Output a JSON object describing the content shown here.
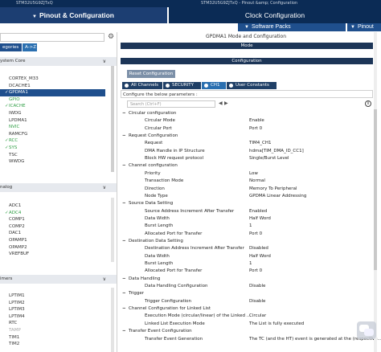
{
  "top": {
    "crumbs_left": "STM32U5G9ZJTxQ",
    "crumbs_mid": "&gt; Pinout &amp; Configuration",
    "crumbs_right": "STM32U5G9ZJTxQ - Pinout &amp; Configuration"
  },
  "tabs": {
    "pinout": "Pinout & Configuration",
    "clock": "Clock Configuration"
  },
  "subtabs": {
    "software_packs": "Software Packs",
    "pinout": "Pinout"
  },
  "left": {
    "category_a": "egories",
    "category_b": "A->Z",
    "sections": [
      {
        "label": "ystem Core",
        "chev": "∨"
      },
      {
        "label": "nalog",
        "chev": "∨"
      },
      {
        "label": "imers",
        "chev": "∨"
      }
    ],
    "system_core_items": [
      {
        "label": "CORTEX_M33",
        "check": "",
        "style": ""
      },
      {
        "label": "DCACHE1",
        "check": "",
        "style": ""
      },
      {
        "label": "GPDMA1",
        "check": "✓",
        "style": "sel"
      },
      {
        "label": "GPIO",
        "check": "",
        "style": "green"
      },
      {
        "label": "ICACHE",
        "check": "✓",
        "style": "green"
      },
      {
        "label": "IWDG",
        "check": "",
        "style": ""
      },
      {
        "label": "LPDMA1",
        "check": "",
        "style": ""
      },
      {
        "label": "NVIC",
        "check": "",
        "style": "green"
      },
      {
        "label": "RAMCFG",
        "check": "",
        "style": ""
      },
      {
        "label": "RCC",
        "check": "✓",
        "style": "green"
      },
      {
        "label": "SYS",
        "check": "✓",
        "style": "green"
      },
      {
        "label": "TSC",
        "check": "",
        "style": ""
      },
      {
        "label": "WWDG",
        "check": "",
        "style": ""
      }
    ],
    "analog_items": [
      {
        "label": "ADC1",
        "check": "",
        "style": ""
      },
      {
        "label": "ADC4",
        "check": "✓",
        "style": "green"
      },
      {
        "label": "COMP1",
        "check": "",
        "style": ""
      },
      {
        "label": "COMP2",
        "check": "",
        "style": ""
      },
      {
        "label": "DAC1",
        "check": "",
        "style": ""
      },
      {
        "label": "OPAMP1",
        "check": "",
        "style": ""
      },
      {
        "label": "OPAMP2",
        "check": "",
        "style": ""
      },
      {
        "label": "VREFBUF",
        "check": "",
        "style": ""
      }
    ],
    "timers_items": [
      {
        "label": "LPTIM1",
        "check": "",
        "style": ""
      },
      {
        "label": "LPTIM2",
        "check": "",
        "style": ""
      },
      {
        "label": "LPTIM3",
        "check": "",
        "style": ""
      },
      {
        "label": "LPTIM4",
        "check": "",
        "style": ""
      },
      {
        "label": "RTC",
        "check": "",
        "style": ""
      },
      {
        "label": "TAMP",
        "check": "",
        "style": "gray"
      },
      {
        "label": "TIM1",
        "check": "",
        "style": ""
      },
      {
        "label": "TIM2",
        "check": "",
        "style": ""
      }
    ]
  },
  "right": {
    "title": "GPDMA1 Mode and Configuration",
    "mode_bar": "Mode",
    "config_bar": "Configuration",
    "reset_button": "Reset Configuration",
    "channel_tabs": [
      {
        "label": "All Channels",
        "active": false
      },
      {
        "label": "SECURITY",
        "active": false
      },
      {
        "label": "CH1",
        "active": true
      },
      {
        "label": "User Constants",
        "active": false
      }
    ],
    "configure_text": "Configure the below parameters :",
    "search_placeholder": "Search (Ctrl+F)",
    "groups": [
      {
        "title": "Circular configuration",
        "params": [
          {
            "name": "Circular Mode",
            "value": "Enable"
          },
          {
            "name": "Circular Port",
            "value": "Port 0"
          }
        ]
      },
      {
        "title": "Request Configuration",
        "params": [
          {
            "name": "Request",
            "value": "TIM4_CH1"
          },
          {
            "name": "DMA Handle in IP Structure",
            "value": "hdma[TIM_DMA_ID_CC1]"
          },
          {
            "name": "Block HW request protocol",
            "value": "Single/Burst Level"
          }
        ]
      },
      {
        "title": "Channel configuration",
        "params": [
          {
            "name": "Priority",
            "value": "Low"
          },
          {
            "name": "Transaction Mode",
            "value": "Normal"
          },
          {
            "name": "Direction",
            "value": "Memory To Peripheral"
          },
          {
            "name": "Node Type",
            "value": "GPDMA Linear Addressing"
          }
        ]
      },
      {
        "title": "Source Data Setting",
        "params": [
          {
            "name": "Source Address Increment After Transfer",
            "value": "Enabled"
          },
          {
            "name": "Data Width",
            "value": "Half Word"
          },
          {
            "name": "Burst Length",
            "value": "1"
          },
          {
            "name": "Allocated Port for Transfer",
            "value": "Port 0"
          }
        ]
      },
      {
        "title": "Destination Data Setting",
        "params": [
          {
            "name": "Destination Address Increment After Transfer",
            "value": "Disabled"
          },
          {
            "name": "Data Width",
            "value": "Half Word"
          },
          {
            "name": "Burst Length",
            "value": "1"
          },
          {
            "name": "Allocated Port for Transfer",
            "value": "Port 0"
          }
        ]
      },
      {
        "title": "Data Handling",
        "params": [
          {
            "name": "Data Handling Configuration",
            "value": "Disable"
          }
        ]
      },
      {
        "title": "Trigger",
        "params": [
          {
            "name": "Trigger Configuration",
            "value": "Disable"
          }
        ]
      },
      {
        "title": "Channel Configuration for Linked List",
        "params": [
          {
            "name": "Execution Mode (circular/linear) of the Linked ...",
            "value": "Circular"
          },
          {
            "name": "Linked List Execution Mode",
            "value": "The List is fully executed"
          }
        ]
      },
      {
        "title": "Transfer Event Configuration",
        "params": [
          {
            "name": "Transfer Event Generation",
            "value": "The TC (and the HT) event is generated at the (respective..."
          }
        ]
      }
    ]
  }
}
